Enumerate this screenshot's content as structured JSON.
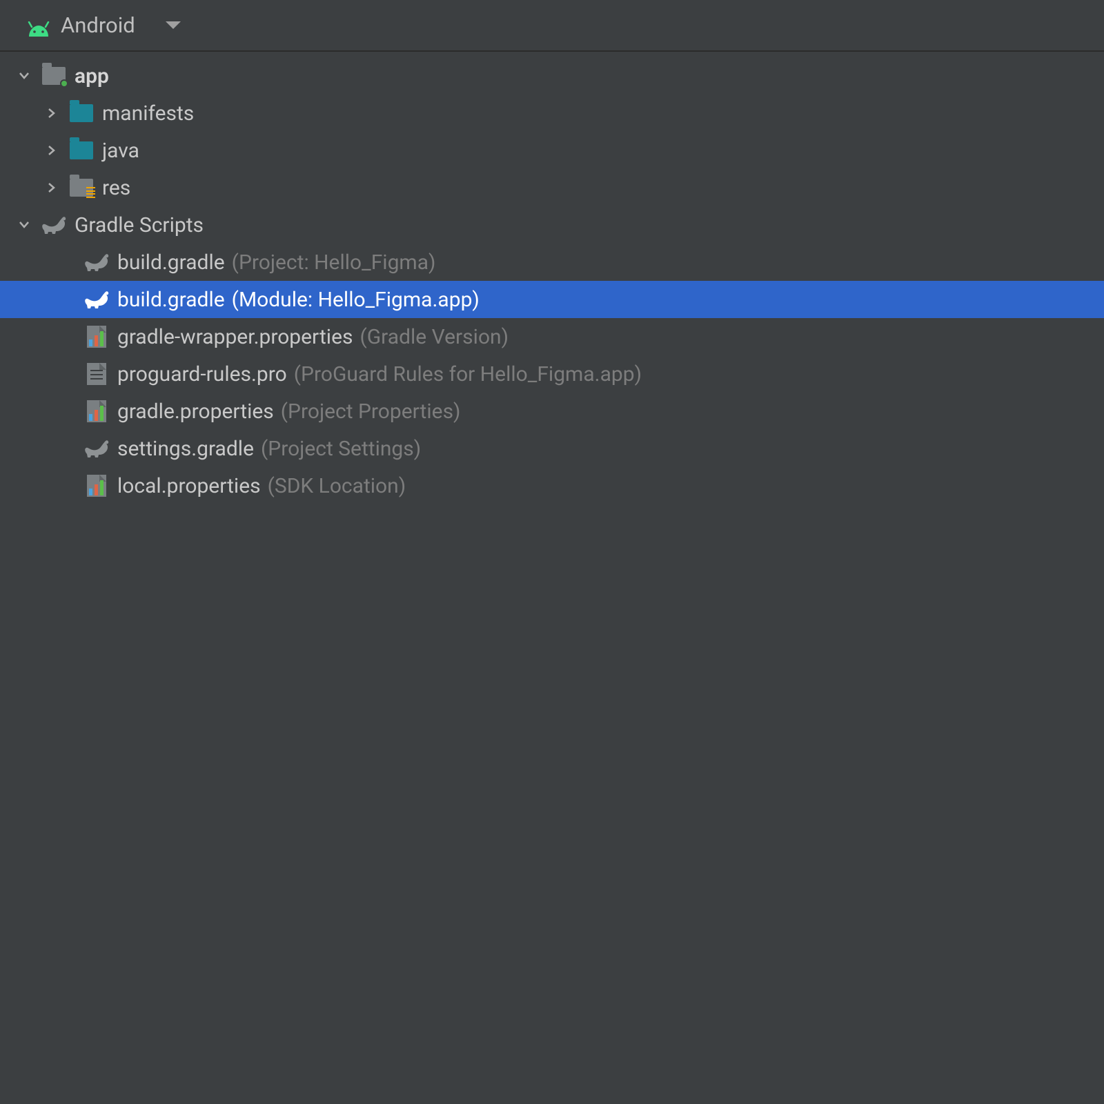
{
  "topbar": {
    "view_label": "Android"
  },
  "tree": {
    "app": {
      "label": "app",
      "manifests": "manifests",
      "java": "java",
      "res": "res"
    },
    "gradle": {
      "label": "Gradle Scripts",
      "items": [
        {
          "name": "build.gradle",
          "paren": "(Project: Hello_Figma)",
          "icon": "elephant"
        },
        {
          "name": "build.gradle",
          "paren": "(Module: Hello_Figma.app)",
          "icon": "elephant",
          "selected": true
        },
        {
          "name": "gradle-wrapper.properties",
          "paren": "(Gradle Version)",
          "icon": "props"
        },
        {
          "name": "proguard-rules.pro",
          "paren": "(ProGuard Rules for Hello_Figma.app)",
          "icon": "file"
        },
        {
          "name": "gradle.properties",
          "paren": "(Project Properties)",
          "icon": "props"
        },
        {
          "name": "settings.gradle",
          "paren": "(Project Settings)",
          "icon": "elephant"
        },
        {
          "name": "local.properties",
          "paren": "(SDK Location)",
          "icon": "props"
        }
      ]
    }
  }
}
